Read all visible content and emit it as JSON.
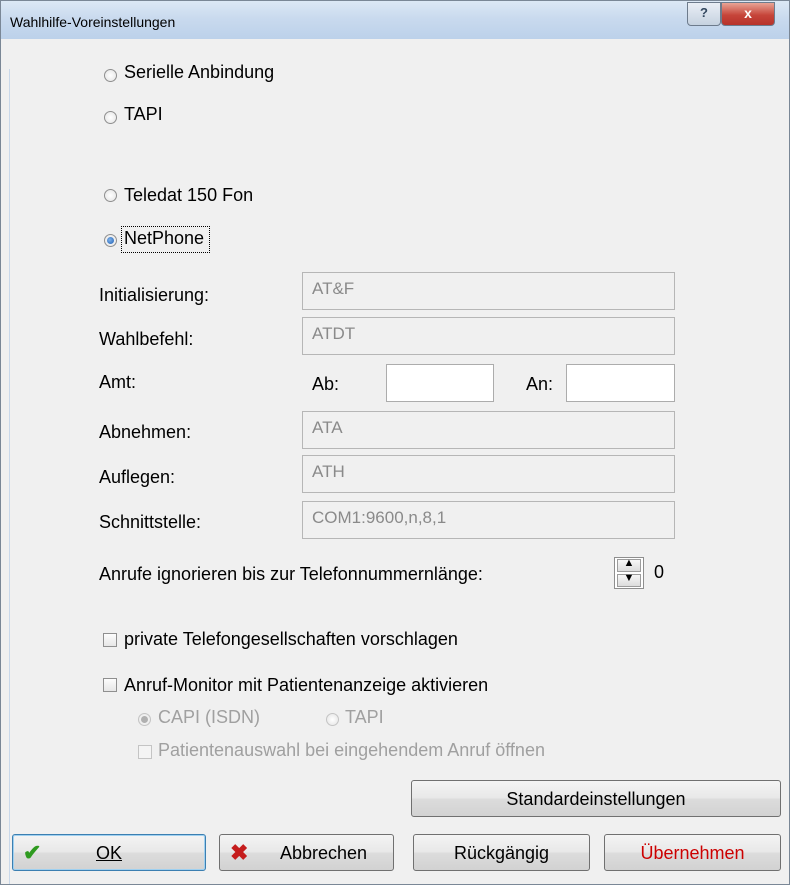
{
  "window": {
    "title": "Wahlhilfe-Voreinstellungen",
    "help_glyph": "?",
    "close_glyph": "x"
  },
  "connection": {
    "serial": {
      "label": "Serielle Anbindung",
      "selected": false
    },
    "tapi": {
      "label": "TAPI",
      "selected": false
    },
    "teledat": {
      "label": "Teledat 150 Fon",
      "selected": false
    },
    "netphone": {
      "label": "NetPhone",
      "selected": true
    }
  },
  "settings": {
    "init": {
      "label": "Initialisierung:",
      "value": "AT&F"
    },
    "dial": {
      "label": "Wahlbefehl:",
      "value": "ATDT"
    },
    "amt": {
      "label": "Amt:",
      "ab_label": "Ab:",
      "ab_value": "",
      "an_label": "An:",
      "an_value": ""
    },
    "pickup": {
      "label": "Abnehmen:",
      "value": "ATA"
    },
    "hangup": {
      "label": "Auflegen:",
      "value": "ATH"
    },
    "port": {
      "label": "Schnittstelle:",
      "value": "COM1:9600,n,8,1"
    },
    "ignore": {
      "label": "Anrufe ignorieren bis zur Telefonnummernlänge:",
      "value": "0",
      "up_glyph": "▲",
      "down_glyph": "▼"
    }
  },
  "options": {
    "private": {
      "label": "private Telefongesellschaften vorschlagen",
      "checked": false
    },
    "monitor": {
      "label": "Anruf-Monitor mit Patientenanzeige aktivieren",
      "checked": false
    },
    "capi": {
      "label": "CAPI (ISDN)",
      "selected": true,
      "enabled": false
    },
    "tapi2": {
      "label": "TAPI",
      "selected": false,
      "enabled": false
    },
    "open_patient": {
      "label": "Patientenauswahl bei eingehendem Anruf öffnen",
      "checked": false,
      "enabled": false
    }
  },
  "buttons": {
    "defaults": "Standardeinstellungen",
    "ok": "OK",
    "ok_icon": "✔",
    "cancel": "Abbrechen",
    "cancel_icon": "✖",
    "undo": "Rückgängig",
    "apply": "Übernehmen"
  },
  "colors": {
    "ok_icon": "#2e9a1f",
    "cancel_icon": "#c51c1c",
    "apply_text": "#cc0000"
  }
}
